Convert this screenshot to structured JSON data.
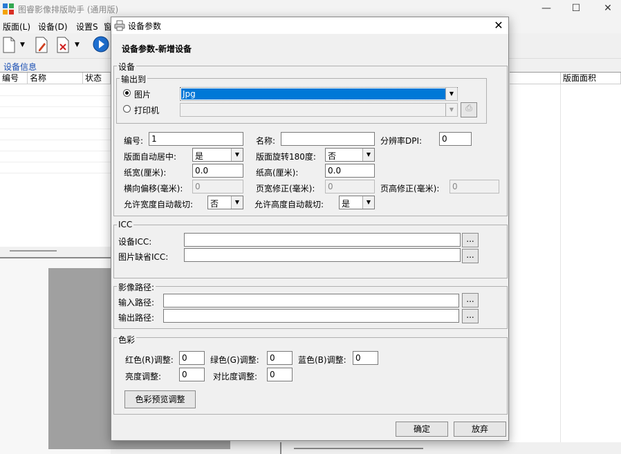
{
  "app": {
    "title": "图睿影像排版助手 (通用版)",
    "minimize": "—",
    "maximize": "☐",
    "close": "✕"
  },
  "menu": [
    {
      "label": "版面(L)"
    },
    {
      "label": "设备(D)"
    },
    {
      "label": "设置S"
    },
    {
      "label": "窗"
    }
  ],
  "main": {
    "group_label": "设备信息",
    "columns": [
      "编号",
      "名称",
      "状态",
      "版面面积"
    ]
  },
  "dialog": {
    "title": "设备参数",
    "heading": "设备参数-新增设备",
    "section_device": "设备",
    "output_group": "输出到",
    "radio_image": "图片",
    "radio_printer": "打印机",
    "image_format": "Jpg",
    "printer_value": "",
    "fields": {
      "id_label": "编号:",
      "id_value": "1",
      "name_label": "名称:",
      "name_value": "",
      "dpi_label": "分辨率DPI:",
      "dpi_value": "0",
      "center_label": "版面自动居中:",
      "center_value": "是",
      "rotate_label": "版面旋转180度:",
      "rotate_value": "否",
      "pw_label": "纸宽(厘米):",
      "pw_value": "0.0",
      "ph_label": "纸高(厘米):",
      "ph_value": "0.0",
      "hoff_label": "横向偏移(毫米):",
      "hoff_value": "0",
      "pwfix_label": "页宽修正(毫米):",
      "pwfix_value": "0",
      "phfix_label": "页高修正(毫米):",
      "phfix_value": "0",
      "cutw_label": "允许宽度自动裁切:",
      "cutw_value": "否",
      "cuth_label": "允许高度自动裁切:",
      "cuth_value": "是"
    },
    "icc": {
      "section": "ICC",
      "device_label": "设备ICC:",
      "device_value": "",
      "image_label": "图片缺省ICC:",
      "image_value": "",
      "browse": "..."
    },
    "path": {
      "section": "影像路径:",
      "input_label": "输入路径:",
      "input_value": "",
      "output_label": "输出路径:",
      "output_value": "",
      "browse": "..."
    },
    "color": {
      "section": "色彩",
      "red_label": "红色(R)调整:",
      "red_value": "0",
      "green_label": "绿色(G)调整:",
      "green_value": "0",
      "blue_label": "蓝色(B)调整:",
      "blue_value": "0",
      "bright_label": "亮度调整:",
      "bright_value": "0",
      "contrast_label": "对比度调整:",
      "contrast_value": "0",
      "preview_button": "色彩预览调整"
    },
    "ok_button": "确定",
    "cancel_button": "放弃",
    "close": "✕"
  },
  "colors": {
    "accent": "#0078d7",
    "group_label": "#1a4fb3"
  }
}
